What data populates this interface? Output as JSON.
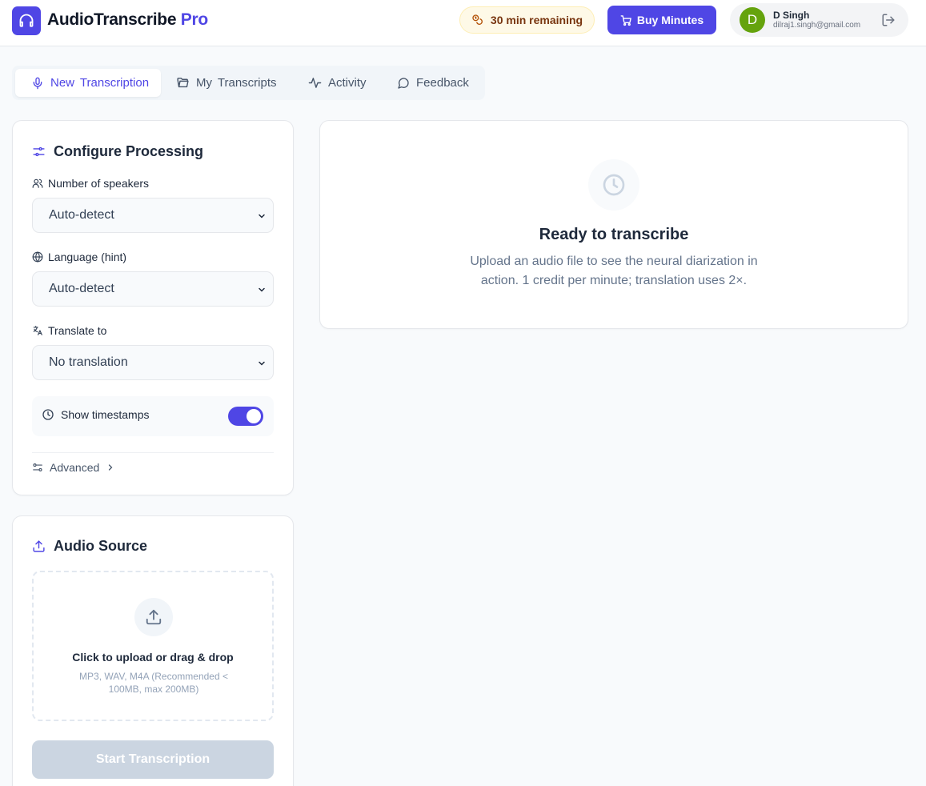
{
  "app": {
    "brand_name": "AudioTranscribe",
    "brand_suffix": "Pro",
    "credits_remaining": "30 min remaining",
    "buy_label": "Buy Minutes"
  },
  "user": {
    "initial": "D",
    "name": "D Singh",
    "email": "dilraj1.singh@gmail.com"
  },
  "tabs": [
    {
      "label": "New Transcription",
      "icon": "microphone-icon",
      "active": true
    },
    {
      "label": "My Transcripts",
      "icon": "folder-open-icon",
      "active": false
    },
    {
      "label": "Activity",
      "icon": "activity-icon",
      "active": false
    },
    {
      "label": "Feedback",
      "icon": "message-circle-icon",
      "active": false
    }
  ],
  "configure": {
    "title": "Configure Processing",
    "speakers_label": "Number of speakers",
    "speakers_value": "Auto-detect",
    "language_label": "Language (hint)",
    "language_value": "Auto-detect",
    "translate_label": "Translate to",
    "translate_value": "No translation",
    "timestamps_label": "Show timestamps",
    "timestamps_on": true,
    "advanced_label": "Advanced"
  },
  "audio_source": {
    "title": "Audio Source",
    "upload_title": "Click to upload or drag & drop",
    "upload_hint": "MP3, WAV, M4A (Recommended < 100MB, max 200MB)",
    "start_label": "Start Transcription"
  },
  "result": {
    "title": "Ready to transcribe",
    "description": "Upload an audio file to see the neural diarization in action. 1 credit per minute; translation uses 2×."
  },
  "colors": {
    "accent": "#4f46e5",
    "credits_bg": "#fef9e7",
    "credits_text": "#78350f",
    "avatar": "#65a30d",
    "disabled_button": "#cbd5e1"
  }
}
